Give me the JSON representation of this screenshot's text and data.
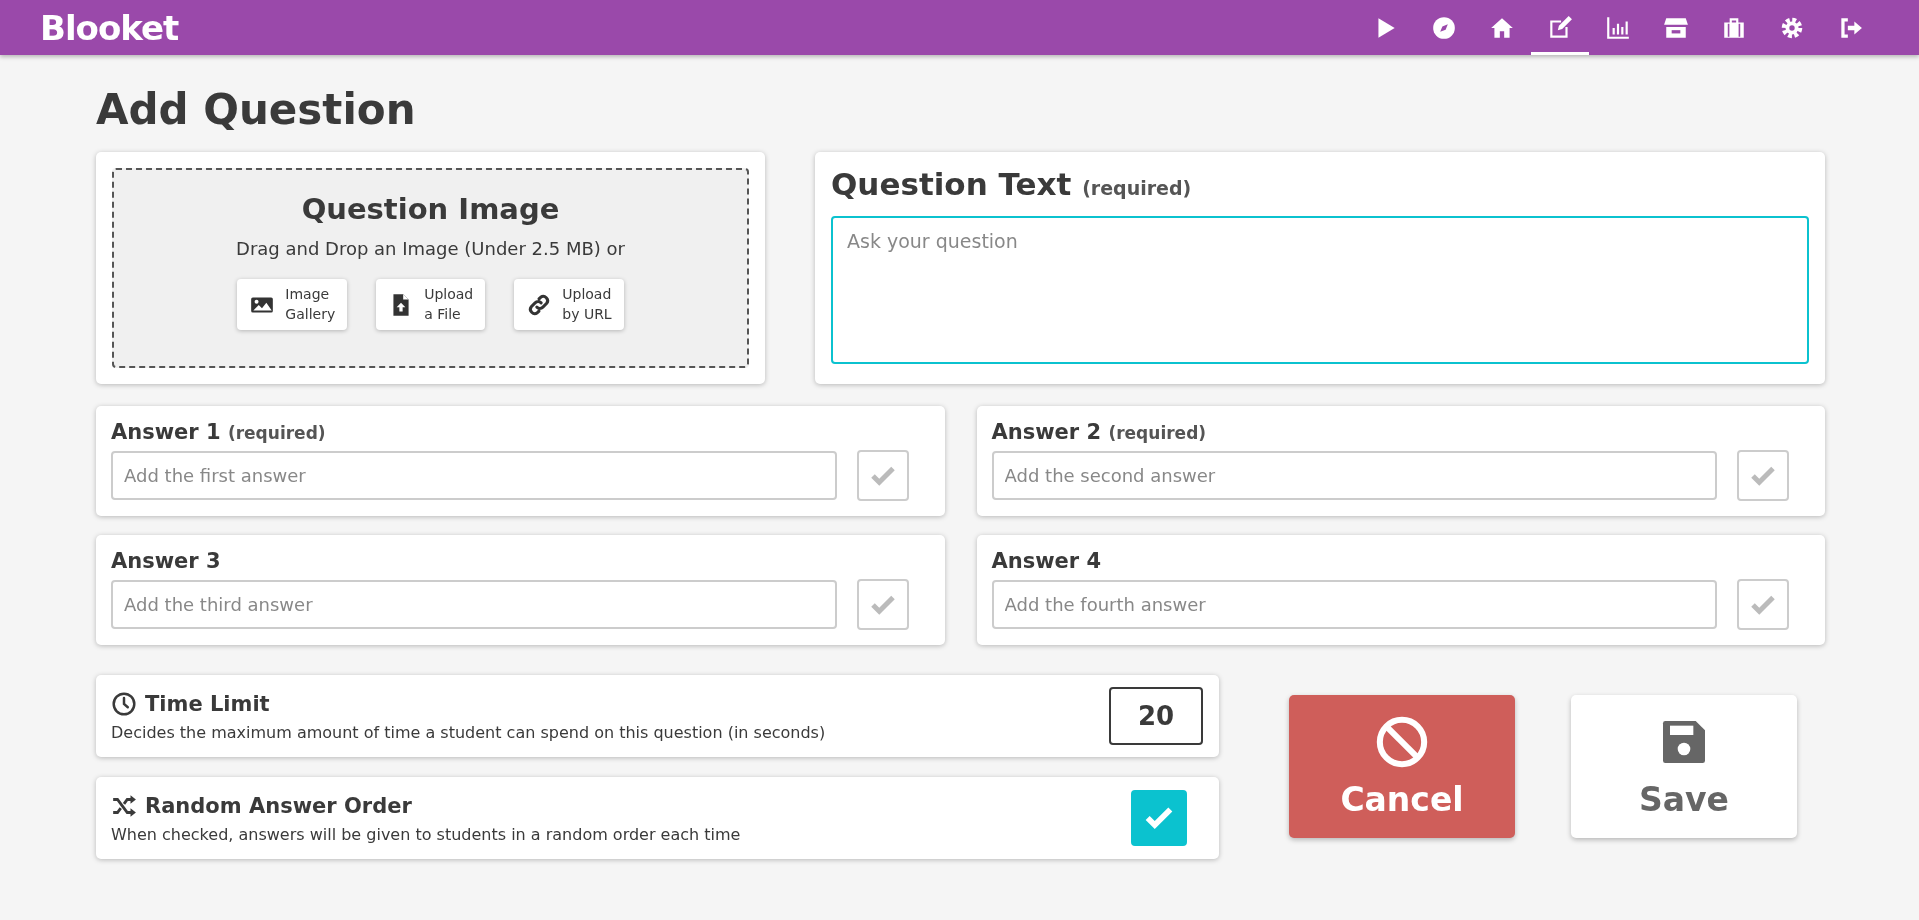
{
  "header": {
    "logo": "Blooket",
    "nav": [
      {
        "selected": false
      },
      {
        "selected": false
      },
      {
        "selected": false
      },
      {
        "selected": true
      },
      {
        "selected": false
      },
      {
        "selected": false
      },
      {
        "selected": false
      },
      {
        "selected": false
      },
      {
        "selected": false
      }
    ]
  },
  "title": "Add Question",
  "image_panel": {
    "heading": "Question Image",
    "hint": "Drag and Drop an Image (Under 2.5 MB) or",
    "buttons": [
      {
        "kind": "gallery",
        "line1": "Image",
        "line2": "Gallery"
      },
      {
        "kind": "file",
        "line1": "Upload",
        "line2": "a File"
      },
      {
        "kind": "url",
        "line1": "Upload",
        "line2": "by URL"
      }
    ]
  },
  "question_text": {
    "heading": "Question Text",
    "note": "(required)",
    "placeholder": "Ask your question",
    "focused": true
  },
  "answers": [
    {
      "label": "Answer 1",
      "note": "(required)",
      "placeholder": "Add the first answer",
      "correct": false
    },
    {
      "label": "Answer 2",
      "note": "(required)",
      "placeholder": "Add the second answer",
      "correct": false
    },
    {
      "label": "Answer 3",
      "placeholder": "Add the third answer",
      "correct": false
    },
    {
      "label": "Answer 4",
      "placeholder": "Add the fourth answer",
      "correct": false
    }
  ],
  "time_limit": {
    "title": "Time Limit",
    "description": "Decides the maximum amount of time a student can spend on this question (in seconds)",
    "value": "20"
  },
  "random_order": {
    "title": "Random Answer Order",
    "description": "When checked, answers will be given to students in a random order each time",
    "checked": true
  },
  "actions": [
    {
      "kind": "cancel",
      "label": "Cancel"
    },
    {
      "kind": "save",
      "label": "Save"
    }
  ]
}
